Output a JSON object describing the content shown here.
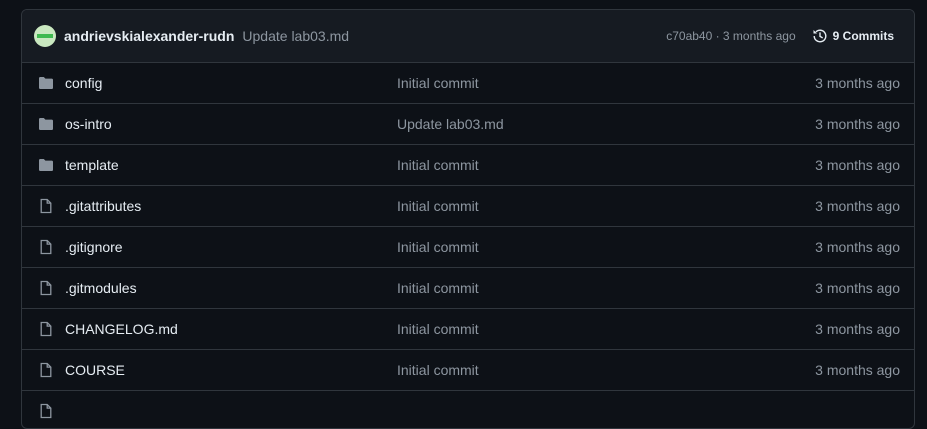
{
  "commit": {
    "author": "andrievskialexander-rudn",
    "message": "Update lab03.md",
    "sha_age": "c70ab40 · 3 months ago",
    "commits_label": "9 Commits"
  },
  "files": [
    {
      "type": "folder",
      "name": "config",
      "message": "Initial commit",
      "age": "3 months ago"
    },
    {
      "type": "folder",
      "name": "os-intro",
      "message": "Update lab03.md",
      "age": "3 months ago"
    },
    {
      "type": "folder",
      "name": "template",
      "message": "Initial commit",
      "age": "3 months ago"
    },
    {
      "type": "file",
      "name": ".gitattributes",
      "message": "Initial commit",
      "age": "3 months ago"
    },
    {
      "type": "file",
      "name": ".gitignore",
      "message": "Initial commit",
      "age": "3 months ago"
    },
    {
      "type": "file",
      "name": ".gitmodules",
      "message": "Initial commit",
      "age": "3 months ago"
    },
    {
      "type": "file",
      "name": "CHANGELOG.md",
      "message": "Initial commit",
      "age": "3 months ago"
    },
    {
      "type": "file",
      "name": "COURSE",
      "message": "Initial commit",
      "age": "3 months ago"
    },
    {
      "type": "file",
      "name": "",
      "message": "",
      "age": ""
    }
  ],
  "colors": {
    "background": "#0d1117",
    "header": "#161b22",
    "border": "#30363d",
    "muted": "#8d96a0",
    "text": "#e6edf3",
    "folder_icon": "#8d96a0"
  }
}
